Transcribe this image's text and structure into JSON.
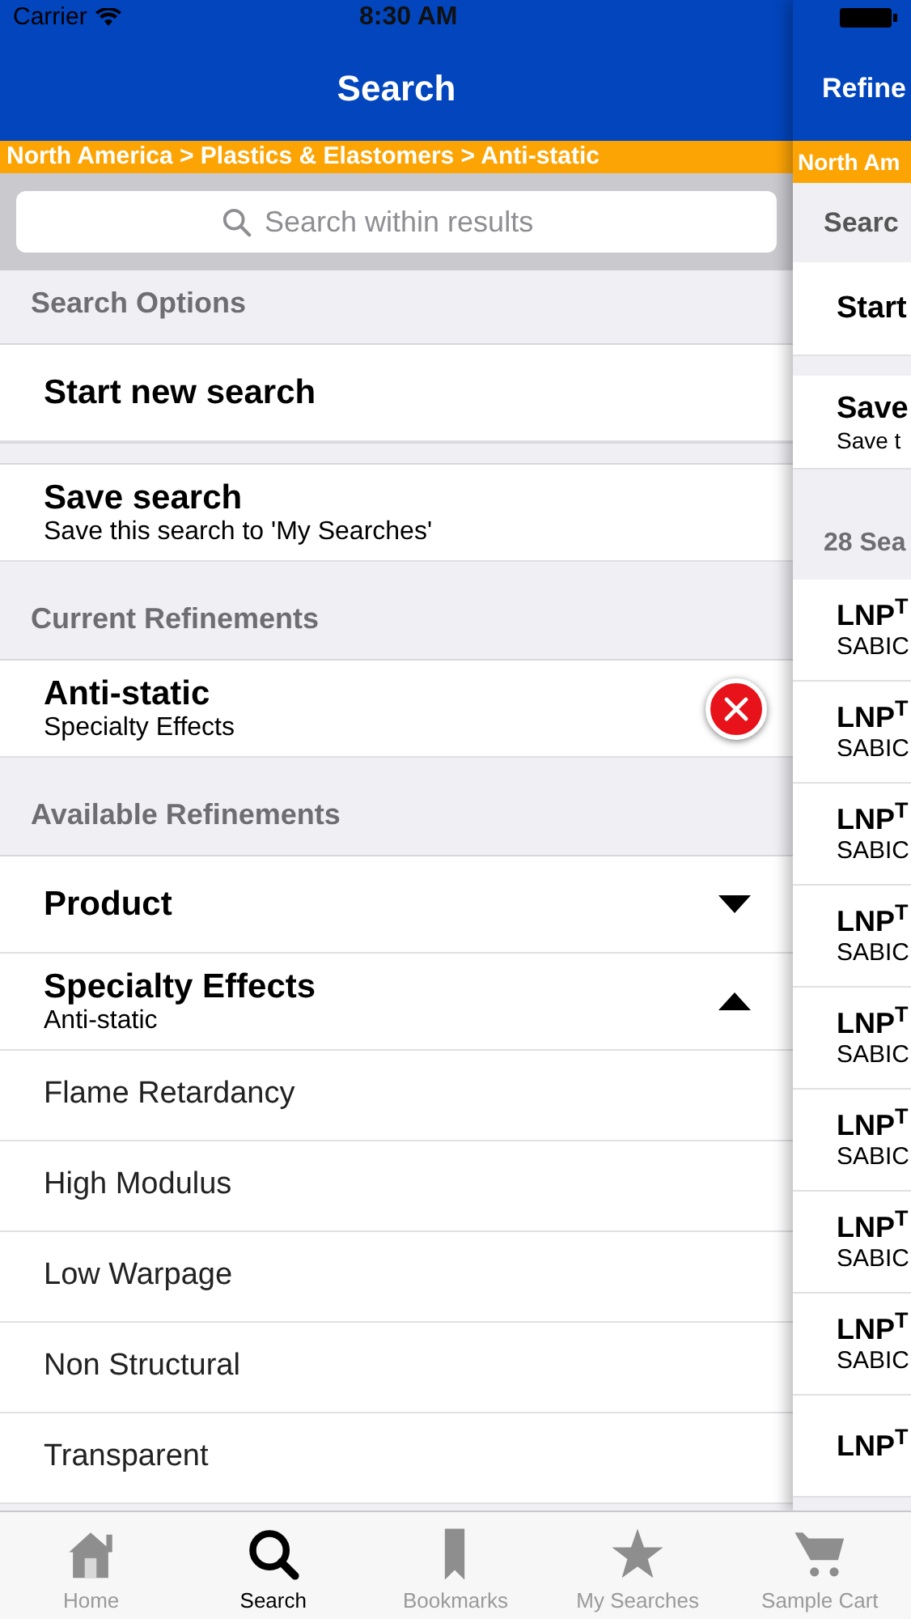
{
  "status_bar": {
    "carrier": "Carrier",
    "time": "8:30 AM"
  },
  "main_panel": {
    "title": "Search",
    "breadcrumb": "North America > Plastics & Elastomers > Anti-static",
    "search": {
      "placeholder": "Search within results"
    },
    "sections": [
      {
        "header": "Search Options",
        "rows": [
          {
            "kind": "action",
            "title": "Start new search"
          },
          {
            "kind": "action",
            "title": "Save search",
            "subtitle": "Save this search to 'My Searches'"
          }
        ]
      },
      {
        "header": "Current Refinements",
        "rows": [
          {
            "kind": "removable",
            "title": "Anti-static",
            "subtitle": "Specialty Effects"
          }
        ]
      },
      {
        "header": "Available Refinements",
        "rows": [
          {
            "kind": "group",
            "title": "Product",
            "expanded": false
          },
          {
            "kind": "group",
            "title": "Specialty Effects",
            "subtitle": "Anti-static",
            "expanded": true
          },
          {
            "kind": "option",
            "title": "Flame Retardancy"
          },
          {
            "kind": "option",
            "title": "High Modulus"
          },
          {
            "kind": "option",
            "title": "Low Warpage"
          },
          {
            "kind": "option",
            "title": "Non Structural"
          },
          {
            "kind": "option",
            "title": "Transparent"
          }
        ]
      }
    ]
  },
  "results_panel": {
    "title": "Refine",
    "breadcrumb": "North Am",
    "section_header": "Searc",
    "rows": [
      {
        "title": "Start"
      },
      {
        "title": "Save",
        "subtitle": "Save t"
      }
    ],
    "results_header": "28 Sea",
    "results": [
      {
        "name": "LNP$^{T}$",
        "maker": "SABIC"
      },
      {
        "name": "LNP$^{T}$",
        "maker": "SABIC"
      },
      {
        "name": "LNP$^{T}$",
        "maker": "SABIC"
      },
      {
        "name": "LNP$^{T}$",
        "maker": "SABIC"
      },
      {
        "name": "LNP$^{T}$",
        "maker": "SABIC"
      },
      {
        "name": "LNP$^{T}$",
        "maker": "SABIC"
      },
      {
        "name": "LNP$^{T}$",
        "maker": "SABIC"
      },
      {
        "name": "LNP$^{T}$",
        "maker": "SABIC"
      },
      {
        "name": "LNP$^{T}$"
      }
    ]
  },
  "tab_bar": [
    {
      "label": "Home",
      "selected": false
    },
    {
      "label": "Search",
      "selected": true
    },
    {
      "label": "Bookmarks",
      "selected": false
    },
    {
      "label": "My Searches",
      "selected": false
    },
    {
      "label": "Sample Cart",
      "selected": false
    }
  ]
}
